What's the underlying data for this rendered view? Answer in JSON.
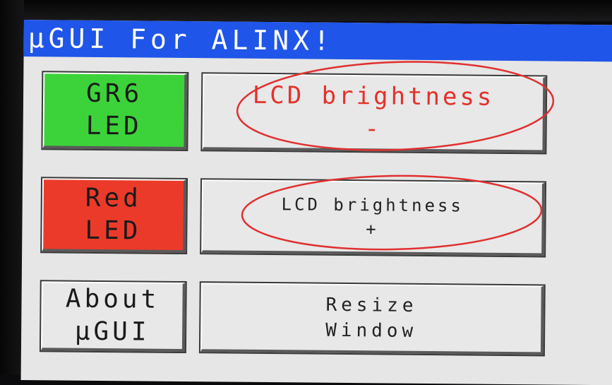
{
  "window": {
    "title": "µGUI For ALINX!"
  },
  "buttons": {
    "green_led": {
      "line1": "GR6",
      "line2": "LED",
      "color": "#3cd33a"
    },
    "brightness_down": {
      "line1": "LCD brightness",
      "line2": "-",
      "text_color": "#e2322a"
    },
    "red_led": {
      "line1": "Red",
      "line2": "LED",
      "color": "#ec3a2a"
    },
    "brightness_up": {
      "line1": "LCD brightness",
      "line2": "+"
    },
    "about": {
      "line1": "About",
      "line2": "µGUI"
    },
    "resize": {
      "line1": "Resize",
      "line2": "Window"
    }
  },
  "colors": {
    "titlebar": "#1f55e8",
    "screen_bg": "#e6e6e6",
    "annotation": "#e03030"
  }
}
